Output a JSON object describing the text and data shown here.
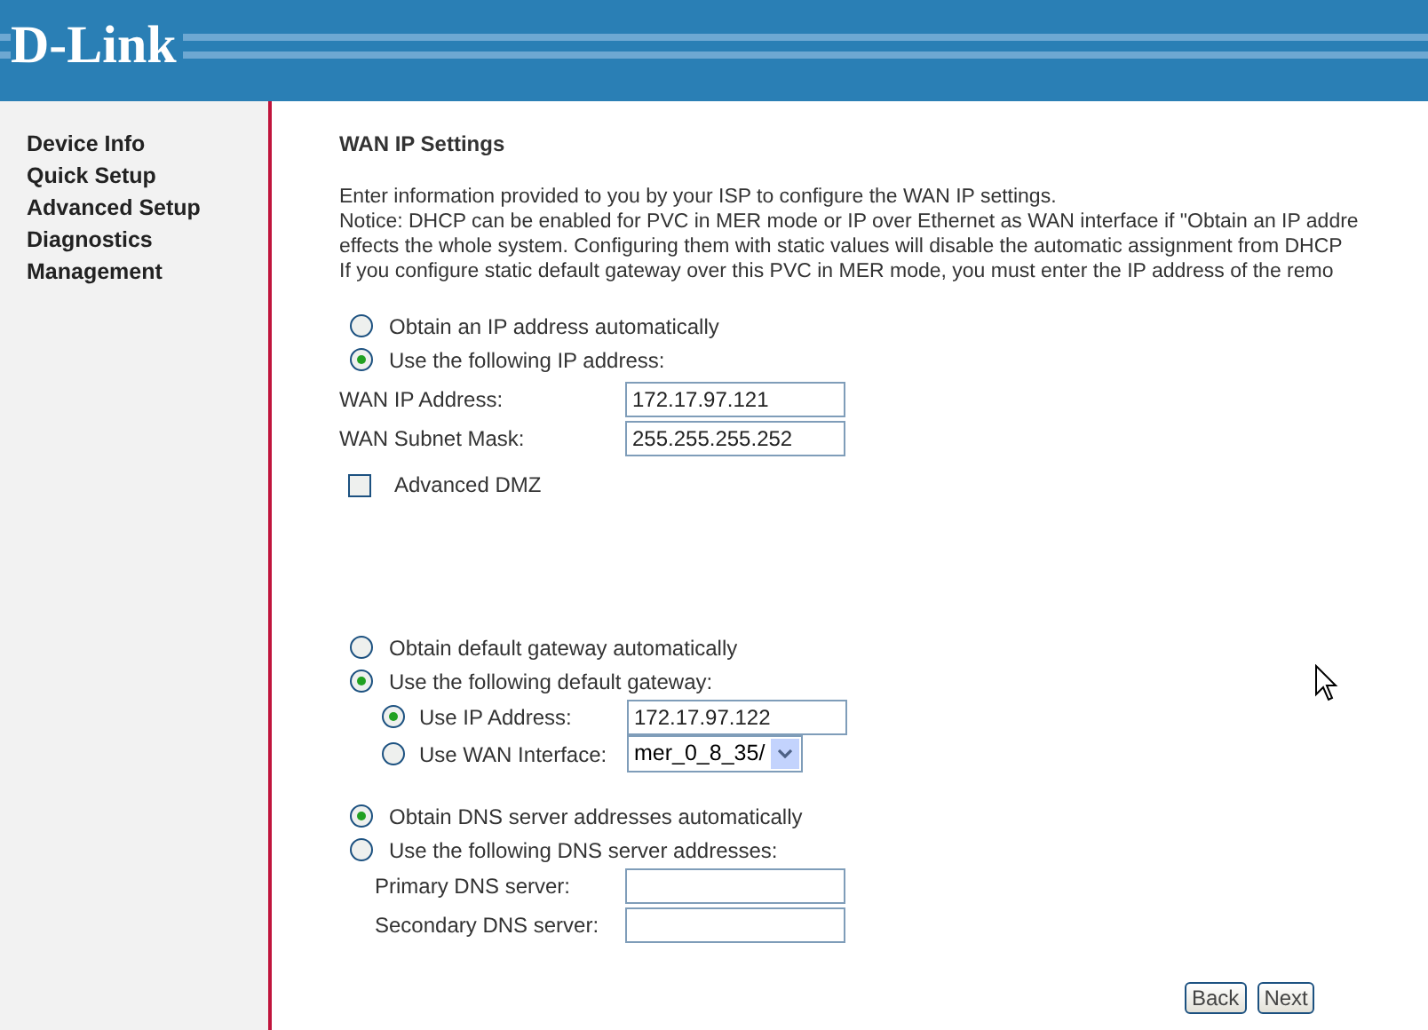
{
  "logo": "D-Link",
  "sidebar": {
    "items": [
      {
        "label": "Device Info"
      },
      {
        "label": "Quick Setup"
      },
      {
        "label": "Advanced Setup"
      },
      {
        "label": "Diagnostics"
      },
      {
        "label": "Management"
      }
    ]
  },
  "title": "WAN IP Settings",
  "intro": [
    "Enter information provided to you by your ISP to configure the WAN IP settings.",
    "Notice: DHCP can be enabled for PVC in MER mode or IP over Ethernet as WAN interface if \"Obtain an IP addre",
    "effects the whole system. Configuring them with static values will disable the automatic assignment from DHCP",
    "If you configure static default gateway over this PVC in MER mode, you must enter the IP address of the remo"
  ],
  "ip_options": [
    {
      "label": "Obtain an IP address automatically",
      "selected": false
    },
    {
      "label": "Use the following IP address:",
      "selected": true
    }
  ],
  "ip_fields": [
    {
      "label": "WAN IP Address:",
      "value": "172.17.97.121"
    },
    {
      "label": "WAN Subnet Mask:",
      "value": "255.255.255.252"
    }
  ],
  "advanced_dmz": {
    "label": "Advanced DMZ",
    "checked": false
  },
  "gateway_options": [
    {
      "label": "Obtain default gateway automatically",
      "selected": false
    },
    {
      "label": "Use the following default gateway:",
      "selected": true
    }
  ],
  "gateway_sub": [
    {
      "kind": "text",
      "label": "Use IP Address:",
      "selected": true,
      "value": "172.17.97.122"
    },
    {
      "kind": "select",
      "label": "Use WAN Interface:",
      "selected": false,
      "value": "mer_0_8_35/"
    }
  ],
  "dns_options": [
    {
      "label": "Obtain DNS server addresses automatically",
      "selected": true
    },
    {
      "label": "Use the following DNS server addresses:",
      "selected": false
    }
  ],
  "dns_fields": [
    {
      "label": "Primary DNS server:"
    },
    {
      "label": "Secondary DNS server:"
    }
  ],
  "buttons": [
    "Back",
    "Next"
  ]
}
